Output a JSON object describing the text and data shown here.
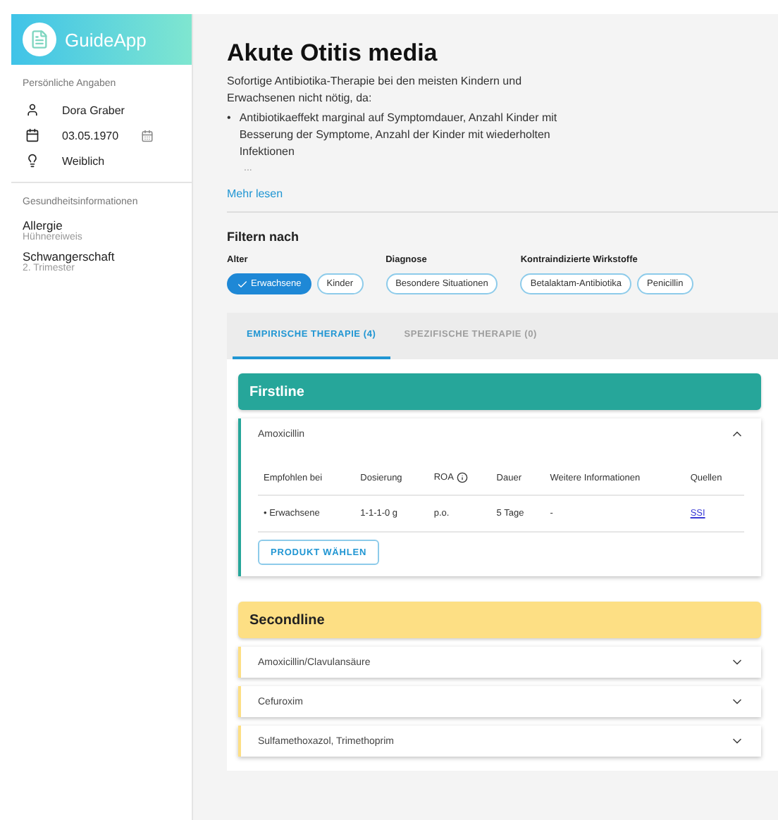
{
  "app": {
    "name": "GuideApp"
  },
  "sidebar": {
    "personal_title": "Persönliche Angaben",
    "personal": [
      {
        "kind": "person",
        "value": "Dora Graber"
      },
      {
        "kind": "date",
        "value": "03.05.1970"
      },
      {
        "kind": "gender",
        "value": "Weiblich"
      }
    ],
    "health_title": "Gesundheitsinformationen",
    "health": [
      {
        "label": "Allergie",
        "detail": "Hühnereiweis"
      },
      {
        "label": "Schwangerschaft",
        "detail": "2. Trimester"
      }
    ]
  },
  "article": {
    "title": "Akute Otitis media",
    "intro": "Sofortige Antibiotika-Therapie bei den meisten Kindern und Erwachsenen nicht nötig, da:",
    "bullet_marker": "•",
    "bullets": [
      "Antibiotikaeffekt marginal auf Symptomdauer, Anzahl Kinder mit Besserung der Symptome, Anzahl der Kinder mit wiederholten Infektionen"
    ],
    "ellipsis": "...",
    "more": "Mehr lesen"
  },
  "filters": {
    "title": "Filtern nach",
    "groups": [
      {
        "label": "Alter",
        "chips": [
          {
            "label": "Erwachsene",
            "selected": true
          },
          {
            "label": "Kinder",
            "selected": false
          }
        ]
      },
      {
        "label": "Diagnose",
        "chips": [
          {
            "label": "Besondere Situationen",
            "selected": false
          }
        ]
      },
      {
        "label": "Kontraindizierte Wirkstoffe",
        "chips": [
          {
            "label": "Betalaktam-Antibiotika",
            "selected": false
          },
          {
            "label": "Penicillin",
            "selected": false
          }
        ]
      }
    ]
  },
  "tabs": [
    {
      "label": "EMPIRISCHE THERAPIE (4)",
      "selected": true,
      "disabled": false
    },
    {
      "label": "SPEZIFISCHE THERAPIE (0)",
      "selected": false,
      "disabled": true
    }
  ],
  "sections": [
    {
      "title": "Firstline",
      "color": "#26a69a",
      "items": [
        {
          "name": "Amoxicillin",
          "expanded": true,
          "table": {
            "columns": [
              "Empfohlen bei",
              "Dosierung",
              "ROA",
              "Dauer",
              "Weitere Informationen",
              "Quellen"
            ],
            "row_marker": "•",
            "rows": [
              [
                "Erwachsene",
                "1-1-1-0 g",
                "p.o.",
                "5 Tage",
                "-",
                "SSI"
              ]
            ]
          },
          "button": "PRODUKT WÄHLEN"
        }
      ]
    },
    {
      "title": "Secondline",
      "color": "#fddf84",
      "items": [
        {
          "name": "Amoxicillin/Clavulansäure",
          "expanded": false
        },
        {
          "name": "Cefuroxim",
          "expanded": false
        },
        {
          "name": "Sulfamethoxazol, Trimethoprim",
          "expanded": false
        }
      ]
    }
  ]
}
